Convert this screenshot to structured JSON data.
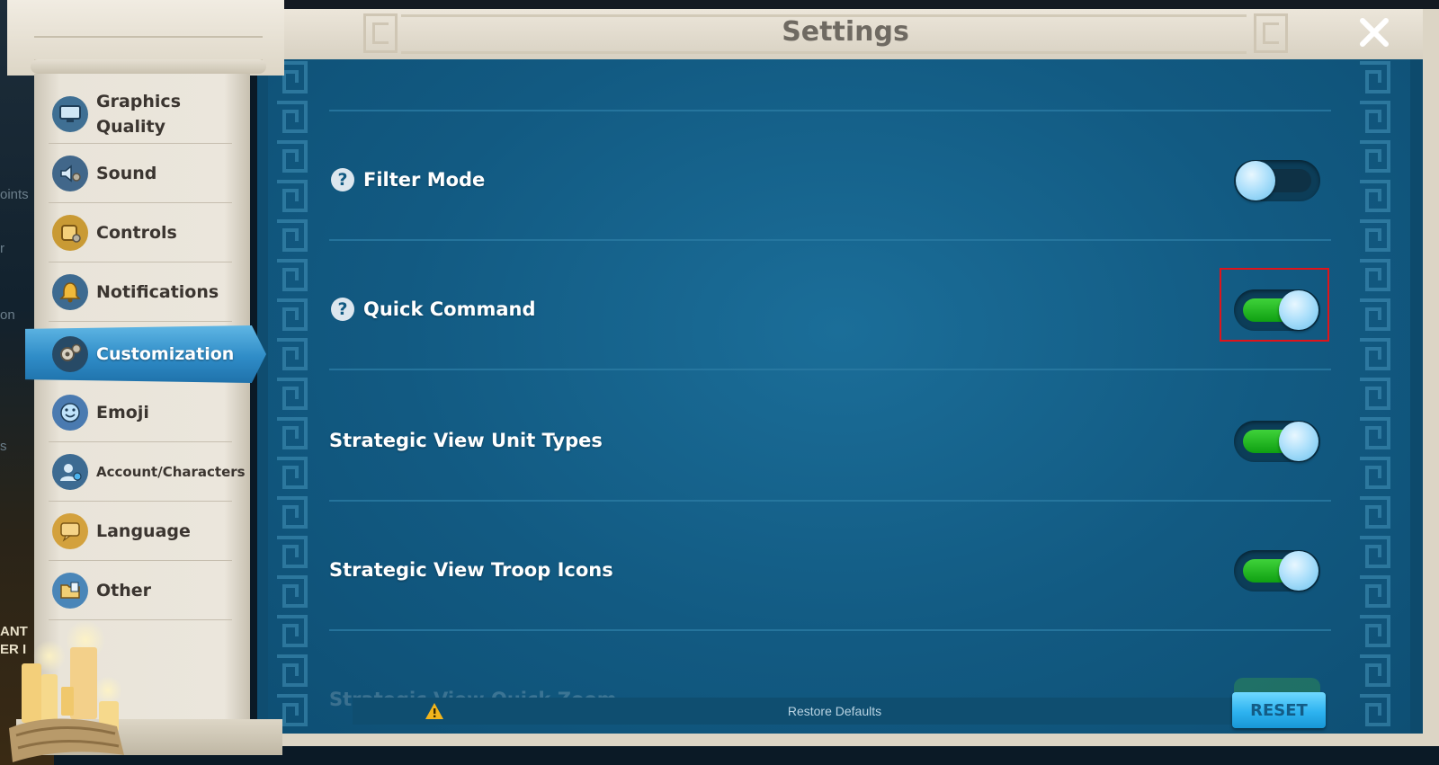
{
  "window": {
    "title": "Settings"
  },
  "background_edge_text": [
    "oints",
    "r",
    "on",
    "s",
    "ANT",
    "ER I"
  ],
  "sidebar": {
    "items": [
      {
        "label": "Graphics\nQuality",
        "icon": "monitor-gear-icon"
      },
      {
        "label": "Sound",
        "icon": "speaker-gear-icon"
      },
      {
        "label": "Controls",
        "icon": "gamepad-gear-icon"
      },
      {
        "label": "Notifications",
        "icon": "bell-icon"
      },
      {
        "label": "Customization",
        "icon": "gears-icon",
        "active": true
      },
      {
        "label": "Emoji",
        "icon": "smiley-icon"
      },
      {
        "label": "Account/Characters",
        "icon": "user-gear-icon"
      },
      {
        "label": "Language",
        "icon": "speech-bubble-icon"
      },
      {
        "label": "Other",
        "icon": "folder-icon"
      }
    ]
  },
  "settings": {
    "rows": [
      {
        "label": "Filter Mode",
        "help": true,
        "enabled": false
      },
      {
        "label": "Quick Command",
        "help": true,
        "enabled": true,
        "highlighted": true
      },
      {
        "label": "Strategic View Unit Types",
        "help": false,
        "enabled": true
      },
      {
        "label": "Strategic View Troop Icons",
        "help": false,
        "enabled": true
      }
    ],
    "partially_visible_row": {
      "label": "Strategic View Quick Zoom",
      "enabled": true
    }
  },
  "footer": {
    "restore_text": "Restore Defaults",
    "reset_label": "RESET",
    "warning_icon": "warning-triangle-icon"
  },
  "colors": {
    "panel_blue": "#125a82",
    "toggle_on": "#1fb11c",
    "knob": "#aee0fb",
    "highlight": "#e0141a",
    "reset_button": "#2eb3f0"
  }
}
